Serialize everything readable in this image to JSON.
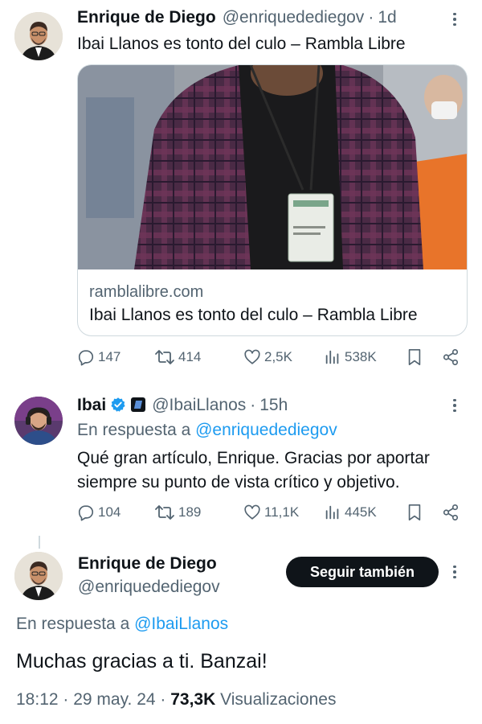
{
  "tweets": [
    {
      "name": "Enrique de Diego",
      "handle": "@enriquedediegov",
      "time": "1d",
      "text": "Ibai Llanos es tonto del culo – Rambla Libre",
      "card": {
        "domain": "ramblalibre.com",
        "title": "Ibai Llanos es tonto del culo – Rambla Libre"
      },
      "stats": {
        "replies": "147",
        "retweets": "414",
        "likes": "2,5K",
        "views": "538K"
      }
    },
    {
      "name": "Ibai",
      "handle": "@IbaiLlanos",
      "time": "15h",
      "reply_prefix": "En respuesta a ",
      "reply_to": "@enriquedediegov",
      "text_line1": "Qué gran artículo, Enrique. Gracias por aportar",
      "text_line2": "siempre su punto de vista crítico y objetivo.",
      "stats": {
        "replies": "104",
        "retweets": "189",
        "likes": "11,1K",
        "views": "445K"
      }
    }
  ],
  "focused": {
    "name": "Enrique de Diego",
    "handle": "@enriquedediegov",
    "follow_label": "Seguir también",
    "reply_prefix": "En respuesta a ",
    "reply_to": "@IbaiLlanos",
    "text": "Muchas gracias a ti. Banzai!",
    "date": "18:12 · 29 may. 24 · ",
    "views_count": "73,3K",
    "views_label": " Visualizaciones"
  },
  "colors": {
    "accent": "#1d9bf0",
    "verified": "#1d9bf0",
    "text": "#0f1419",
    "muted": "#536471"
  },
  "icons": [
    "reply-icon",
    "retweet-icon",
    "like-icon",
    "views-icon",
    "bookmark-icon",
    "share-icon",
    "more-icon",
    "verified-icon",
    "affiliate-badge-icon"
  ]
}
